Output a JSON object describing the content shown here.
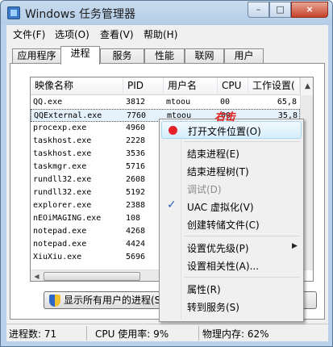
{
  "window": {
    "title": "Windows 任务管理器",
    "minimize_glyph": "–",
    "maximize_glyph": "□",
    "close_glyph": "×"
  },
  "menubar": [
    "文件(F)",
    "选项(O)",
    "查看(V)",
    "帮助(H)"
  ],
  "tabs": [
    "应用程序",
    "进程",
    "服务",
    "性能",
    "联网",
    "用户"
  ],
  "active_tab": "进程",
  "columns": [
    "映像名称",
    "PID",
    "用户名",
    "CPU",
    "工作设置("
  ],
  "processes": [
    {
      "name": "QQ.exe",
      "pid": "3812",
      "user": "mtoou",
      "cpu": "00",
      "mem": "65,8"
    },
    {
      "name": "QQExternal.exe",
      "pid": "7760",
      "user": "mtoou",
      "cpu": "00",
      "mem": "35,8"
    },
    {
      "name": "procexp.exe",
      "pid": "4960",
      "user": "",
      "cpu": "",
      "mem": ""
    },
    {
      "name": "taskhost.exe",
      "pid": "2228",
      "user": "",
      "cpu": "",
      "mem": ""
    },
    {
      "name": "taskhost.exe",
      "pid": "3536",
      "user": "",
      "cpu": "",
      "mem": ""
    },
    {
      "name": "taskmgr.exe",
      "pid": "5716",
      "user": "",
      "cpu": "",
      "mem": ""
    },
    {
      "name": "rundll32.exe",
      "pid": "2608",
      "user": "",
      "cpu": "",
      "mem": ""
    },
    {
      "name": "rundll32.exe",
      "pid": "5192",
      "user": "",
      "cpu": "",
      "mem": ""
    },
    {
      "name": "explorer.exe",
      "pid": "2388",
      "user": "",
      "cpu": "",
      "mem": ""
    },
    {
      "name": "nEOiMAGING.exe",
      "pid": "108",
      "user": "",
      "cpu": "",
      "mem": ""
    },
    {
      "name": "notepad.exe",
      "pid": "4268",
      "user": "",
      "cpu": "",
      "mem": ""
    },
    {
      "name": "notepad.exe",
      "pid": "4424",
      "user": "",
      "cpu": "",
      "mem": ""
    },
    {
      "name": "XiuXiu.exe",
      "pid": "5696",
      "user": "",
      "cpu": "",
      "mem": ""
    }
  ],
  "selected_process": "QQExternal.exe",
  "show_all_button": "显示所有用户的进程(S)",
  "annotation": "右击",
  "context_menu": [
    {
      "label": "打开文件位置(O)",
      "icon": "red-dot",
      "highlighted": true
    },
    {
      "separator": true
    },
    {
      "label": "结束进程(E)"
    },
    {
      "label": "结束进程树(T)"
    },
    {
      "label": "调试(D)",
      "disabled": true
    },
    {
      "label": "UAC 虚拟化(V)",
      "checked": true
    },
    {
      "label": "创建转储文件(C)"
    },
    {
      "separator": true
    },
    {
      "label": "设置优先级(P)",
      "submenu": true
    },
    {
      "label": "设置相关性(A)..."
    },
    {
      "separator": true
    },
    {
      "label": "属性(R)"
    },
    {
      "label": "转到服务(S)"
    }
  ],
  "status": {
    "processes": "进程数: 71",
    "cpu": "CPU 使用率: 9%",
    "memory": "物理内存: 62%"
  },
  "colors": {
    "accent": "#e2201e",
    "selection": "#e5f1fb",
    "menu_highlight": "#d5edfb"
  }
}
